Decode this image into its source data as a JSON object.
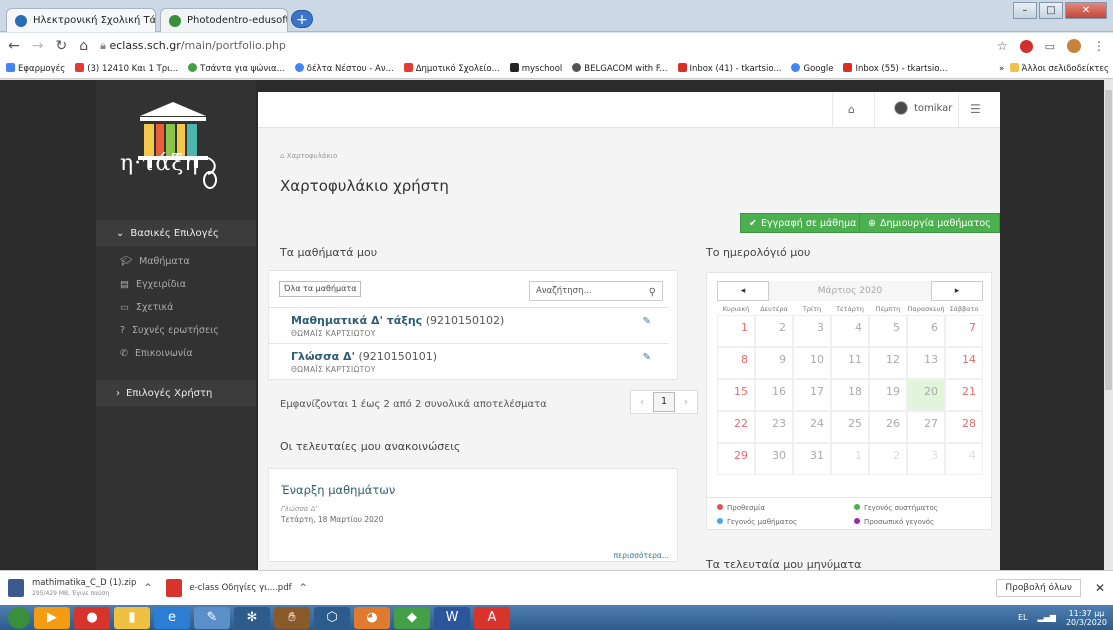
{
  "browser": {
    "tabs": [
      {
        "title": "Ηλεκτρονική Σχολική Τάξη (η-Τά",
        "active": true
      },
      {
        "title": "Photodentro-edusoft: Μαθηματι",
        "active": false
      }
    ],
    "url_host": "eclass.sch.gr",
    "url_path": "/main/portfolio.php",
    "bookmarks": [
      {
        "label": "Εφαρμογές",
        "color": "#4285f4"
      },
      {
        "label": "(3) 12410 Και 1 Τρι...",
        "color": "#e53935"
      },
      {
        "label": "Τσάντα για ψώνια...",
        "color": "#43a047"
      },
      {
        "label": "δέλτα Νέστου - Αν...",
        "color": "#4285f4"
      },
      {
        "label": "Δημοτικό Σχολείο...",
        "color": "#e53935"
      },
      {
        "label": "myschool",
        "color": "#222222"
      },
      {
        "label": "BELGACOM with F...",
        "color": "#555555"
      },
      {
        "label": "Inbox (41) - tkartsio...",
        "color": "#d93025"
      },
      {
        "label": "Google",
        "color": "#4285f4"
      },
      {
        "label": "Inbox (55) - tkartsio...",
        "color": "#d93025"
      }
    ],
    "bookmarks_more": "»",
    "other_bookmarks": "Άλλοι σελιδοδείκτες"
  },
  "sidebar": {
    "logo_text": "η·τάξη",
    "section_main": "Βασικές Επιλογές",
    "items": [
      {
        "label": "Μαθήματα",
        "icon": "graduation-cap-icon"
      },
      {
        "label": "Εγχειρίδια",
        "icon": "file-icon"
      },
      {
        "label": "Σχετικά",
        "icon": "card-icon"
      },
      {
        "label": "Συχνές ερωτήσεις",
        "icon": "question-icon"
      },
      {
        "label": "Επικοινωνία",
        "icon": "phone-icon"
      }
    ],
    "section_user": "Επιλογές Χρήστη"
  },
  "topnav": {
    "username": "tomikar"
  },
  "breadcrumb": "Χαρτοφυλάκιο",
  "page_title": "Χαρτοφυλάκιο χρήστη",
  "actions": {
    "register": "Εγγραφή σε μάθημα",
    "create": "Δημιουργία μαθήματος"
  },
  "courses": {
    "heading": "Τα μαθήματά μου",
    "filter": "Όλα τα μαθήματα",
    "search_placeholder": "Αναζήτηση...",
    "rows": [
      {
        "name": "Μαθηματικά Δ' τάξης",
        "code": "(9210150102)",
        "teacher": "ΘΩΜΑΪΣ ΚΑΡΤΣΙΩΤΟΥ"
      },
      {
        "name": "Γλώσσα Δ'",
        "code": "(9210150101)",
        "teacher": "ΘΩΜΑΪΣ ΚΑΡΤΣΙΩΤΟΥ"
      }
    ],
    "results_text": "Εμφανίζονται 1 έως 2 από 2 συνολικά αποτελέσματα",
    "page": "1",
    "prev": "‹",
    "next": "›"
  },
  "announcements": {
    "heading": "Οι τελευταίες μου ανακοινώσεις",
    "title": "Έναρξη μαθημάτων",
    "course": "Γλώσσα Δ'",
    "date": "Τετάρτη, 18 Μαρτίου 2020",
    "more": "περισσότερα..."
  },
  "calendar": {
    "heading": "Το ημερολόγιό μου",
    "month": "Μάρτιος 2020",
    "prev": "◂",
    "next": "▸",
    "dow": [
      "Κυριακή",
      "Δευτέρα",
      "Τρίτη",
      "Τετάρτη",
      "Πέμπτη",
      "Παρασκευή",
      "Σάββατο"
    ],
    "weeks": [
      [
        "1",
        "2",
        "3",
        "4",
        "5",
        "6",
        "7"
      ],
      [
        "8",
        "9",
        "10",
        "11",
        "12",
        "13",
        "14"
      ],
      [
        "15",
        "16",
        "17",
        "18",
        "19",
        "20",
        "21"
      ],
      [
        "22",
        "23",
        "24",
        "25",
        "26",
        "27",
        "28"
      ],
      [
        "29",
        "30",
        "31",
        "1",
        "2",
        "3",
        "4"
      ]
    ],
    "today": "20",
    "legend": [
      {
        "label": "Προθεσμία",
        "color": "#e05252"
      },
      {
        "label": "Γεγονός συστήματος",
        "color": "#4caf50"
      },
      {
        "label": "Γεγονός μαθήματος",
        "color": "#42a5f5"
      },
      {
        "label": "Προσωπικό γεγονός",
        "color": "#9c27b0"
      }
    ]
  },
  "messages": {
    "heading": "Τα τελευταία μου μηνύματα"
  },
  "downloads": [
    {
      "name": "mathimatika_C_D (1).zip",
      "sub": "295/429 MB, Έγινε παύση"
    },
    {
      "name": "e-class Οδηγίες γι....pdf",
      "sub": ""
    }
  ],
  "show_all": "Προβολή όλων",
  "tray": {
    "lang": "EL",
    "time": "11:37 μμ",
    "date": "20/3/2020"
  }
}
